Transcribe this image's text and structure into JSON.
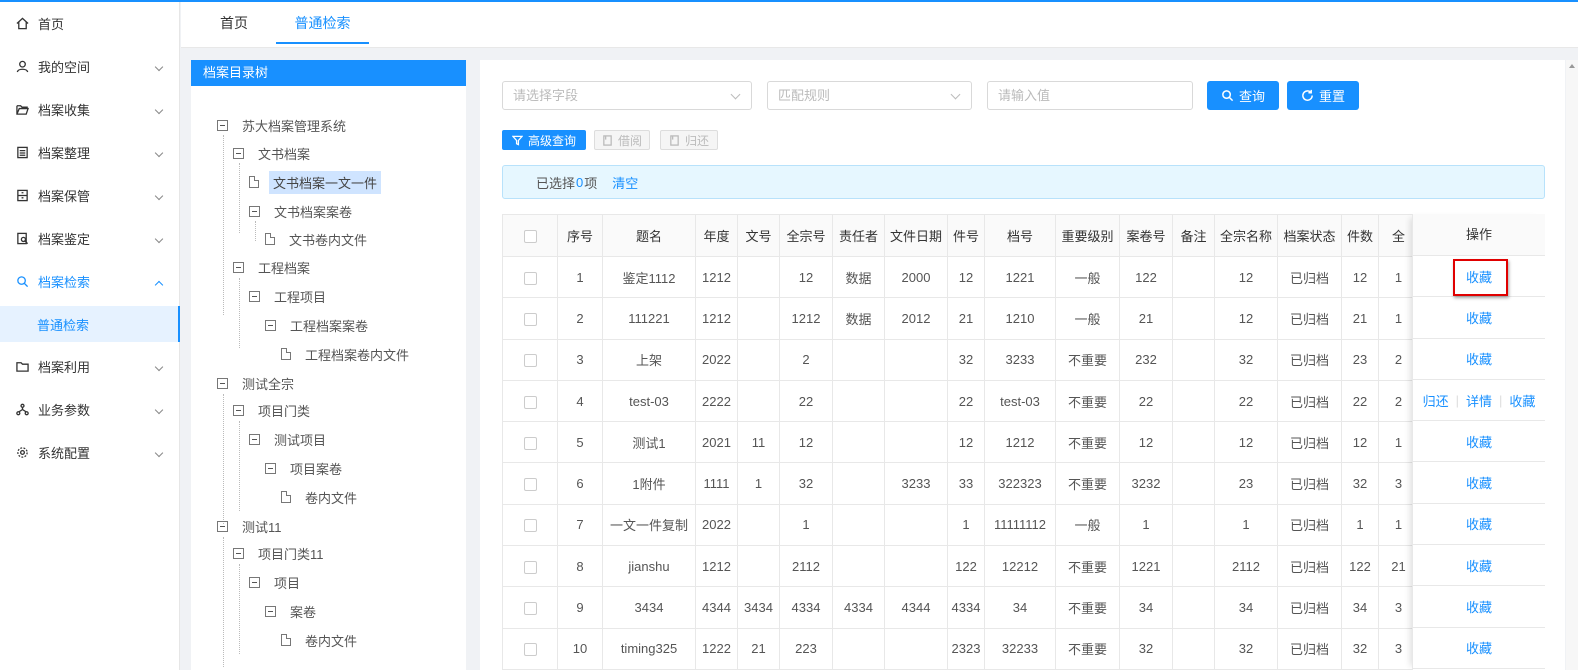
{
  "sidebar": {
    "items": [
      {
        "label": "首页",
        "icon": "home-icon"
      },
      {
        "label": "我的空间",
        "icon": "user-icon"
      },
      {
        "label": "档案收集",
        "icon": "folder-open-icon"
      },
      {
        "label": "档案整理",
        "icon": "list-icon"
      },
      {
        "label": "档案保管",
        "icon": "archive-icon"
      },
      {
        "label": "档案鉴定",
        "icon": "appraise-icon"
      },
      {
        "label": "档案检索",
        "icon": "search-icon"
      },
      {
        "label": "档案利用",
        "icon": "folder-icon"
      },
      {
        "label": "业务参数",
        "icon": "hierarchy-icon"
      },
      {
        "label": "系统配置",
        "icon": "gear-icon"
      }
    ],
    "sub_item": "普通检索"
  },
  "tabs": [
    "首页",
    "普通检索"
  ],
  "tree": {
    "title": "档案目录树",
    "nodes": [
      "苏大档案管理系统",
      "文书档案",
      "文书档案一文一件",
      "文书档案案卷",
      "文书卷内文件",
      "工程档案",
      "工程项目",
      "工程档案案卷",
      "工程档案卷内文件",
      "测试全宗",
      "项目门类",
      "测试项目",
      "项目案卷",
      "卷内文件",
      "测试11",
      "项目门类11",
      "项目",
      "案卷",
      "卷内文件"
    ]
  },
  "search": {
    "field_placeholder": "请选择字段",
    "rule_placeholder": "匹配规则",
    "value_placeholder": "请输入值",
    "query_label": "查询",
    "reset_label": "重置"
  },
  "actions": {
    "advanced_label": "高级查询",
    "borrow_label": "借阅",
    "return_label": "归还"
  },
  "selection": {
    "prefix": "已选择",
    "count": "0",
    "suffix": "项",
    "clear_label": "清空"
  },
  "table": {
    "headers": [
      "序号",
      "题名",
      "年度",
      "文号",
      "全宗号",
      "责任者",
      "文件日期",
      "件号",
      "档号",
      "重要级别",
      "案卷号",
      "备注",
      "全宗名称",
      "档案状态",
      "件数",
      "全"
    ],
    "rows": [
      [
        "1",
        "鉴定1112",
        "1212",
        "",
        "12",
        "数据",
        "2000",
        "12",
        "1221",
        "一般",
        "122",
        "",
        "12",
        "已归档",
        "12",
        "1"
      ],
      [
        "2",
        "111221",
        "1212",
        "",
        "1212",
        "数据",
        "2012",
        "21",
        "1210",
        "一般",
        "21",
        "",
        "12",
        "已归档",
        "21",
        "1"
      ],
      [
        "3",
        "上架",
        "2022",
        "",
        "2",
        "",
        "",
        "32",
        "3233",
        "不重要",
        "232",
        "",
        "32",
        "已归档",
        "23",
        "2"
      ],
      [
        "4",
        "test-03",
        "2222",
        "",
        "22",
        "",
        "",
        "22",
        "test-03",
        "不重要",
        "22",
        "",
        "22",
        "已归档",
        "22",
        "2"
      ],
      [
        "5",
        "测试1",
        "2021",
        "11",
        "12",
        "",
        "",
        "12",
        "1212",
        "不重要",
        "12",
        "",
        "12",
        "已归档",
        "12",
        "1"
      ],
      [
        "6",
        "1附件",
        "1111",
        "1",
        "32",
        "",
        "3233",
        "33",
        "322323",
        "不重要",
        "3232",
        "",
        "23",
        "已归档",
        "32",
        "3"
      ],
      [
        "7",
        "一文一件复制",
        "2022",
        "",
        "1",
        "",
        "",
        "1",
        "11111112",
        "一般",
        "1",
        "",
        "1",
        "已归档",
        "1",
        "1"
      ],
      [
        "8",
        "jianshu",
        "1212",
        "",
        "2112",
        "",
        "",
        "122",
        "12212",
        "不重要",
        "1221",
        "",
        "2112",
        "已归档",
        "122",
        "21"
      ],
      [
        "9",
        "3434",
        "4344",
        "3434",
        "4334",
        "4334",
        "4344",
        "4334",
        "34",
        "不重要",
        "34",
        "",
        "34",
        "已归档",
        "34",
        "3"
      ],
      [
        "10",
        "timing325",
        "1222",
        "21",
        "223",
        "",
        "",
        "2323",
        "32233",
        "不重要",
        "32",
        "",
        "32",
        "已归档",
        "32",
        "3"
      ]
    ],
    "ops_header": "操作",
    "ops": [
      [
        "收藏"
      ],
      [
        "收藏"
      ],
      [
        "收藏"
      ],
      [
        "归还",
        "详情",
        "收藏"
      ],
      [
        "收藏"
      ],
      [
        "收藏"
      ],
      [
        "收藏"
      ],
      [
        "收藏"
      ],
      [
        "收藏"
      ],
      [
        "收藏"
      ]
    ]
  },
  "colors": {
    "accent": "#1890ff",
    "highlight": "#e00000"
  }
}
